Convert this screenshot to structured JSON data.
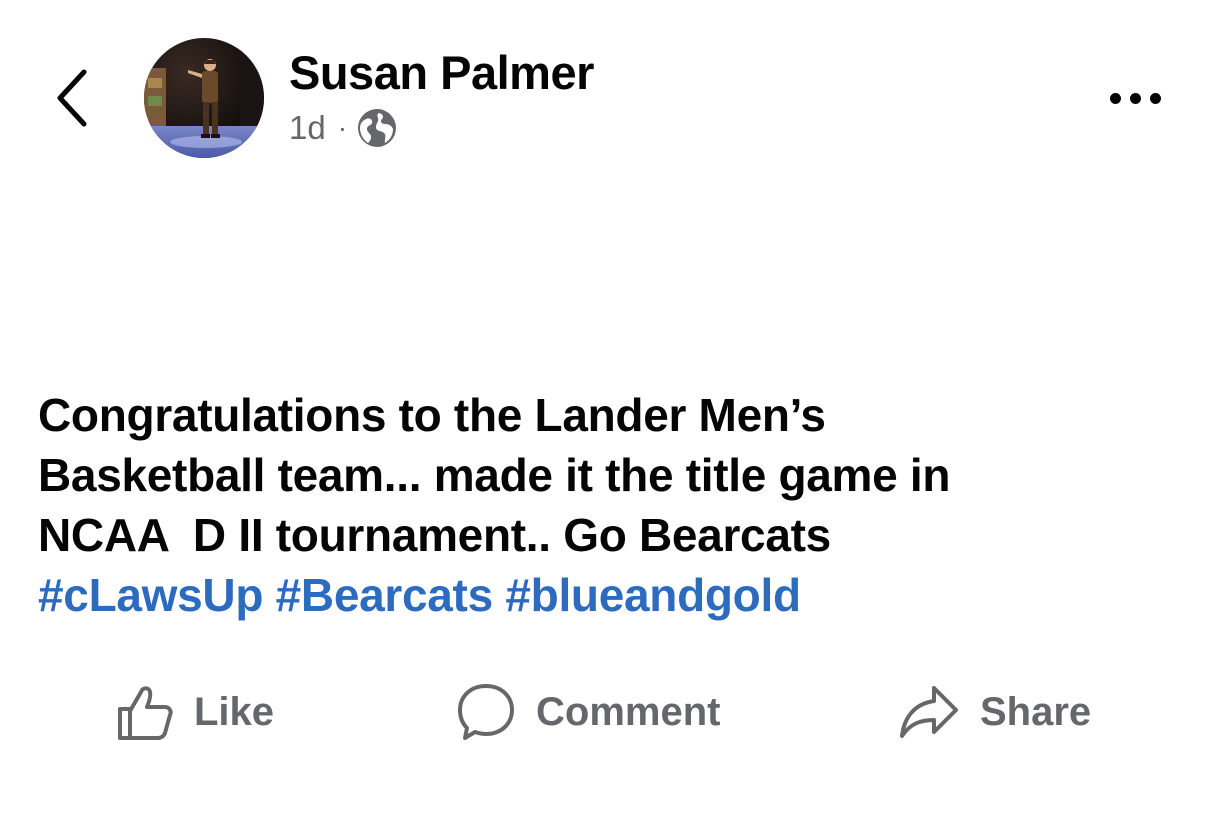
{
  "header": {
    "author_name": "Susan Palmer",
    "time_ago": "1d",
    "separator": "·",
    "audience_icon": "globe-icon",
    "back_icon": "chevron-left-icon",
    "more_icon": "more-horizontal-icon"
  },
  "post": {
    "lines": [
      "Congratulations to the Lander Men’s",
      "Basketball team... made it the title game in",
      "NCAA  D II tournament.. Go Bearcats"
    ],
    "hashtags": [
      "#cLawsUp",
      "#Bearcats",
      "#blueandgold"
    ]
  },
  "actions": {
    "like_label": "Like",
    "comment_label": "Comment",
    "share_label": "Share",
    "like_icon": "thumbs-up-icon",
    "comment_icon": "speech-bubble-icon",
    "share_icon": "share-arrow-icon"
  },
  "colors": {
    "text": "#050505",
    "secondary": "#65676b",
    "hashtag": "#2d6bbf",
    "background": "#ffffff"
  }
}
